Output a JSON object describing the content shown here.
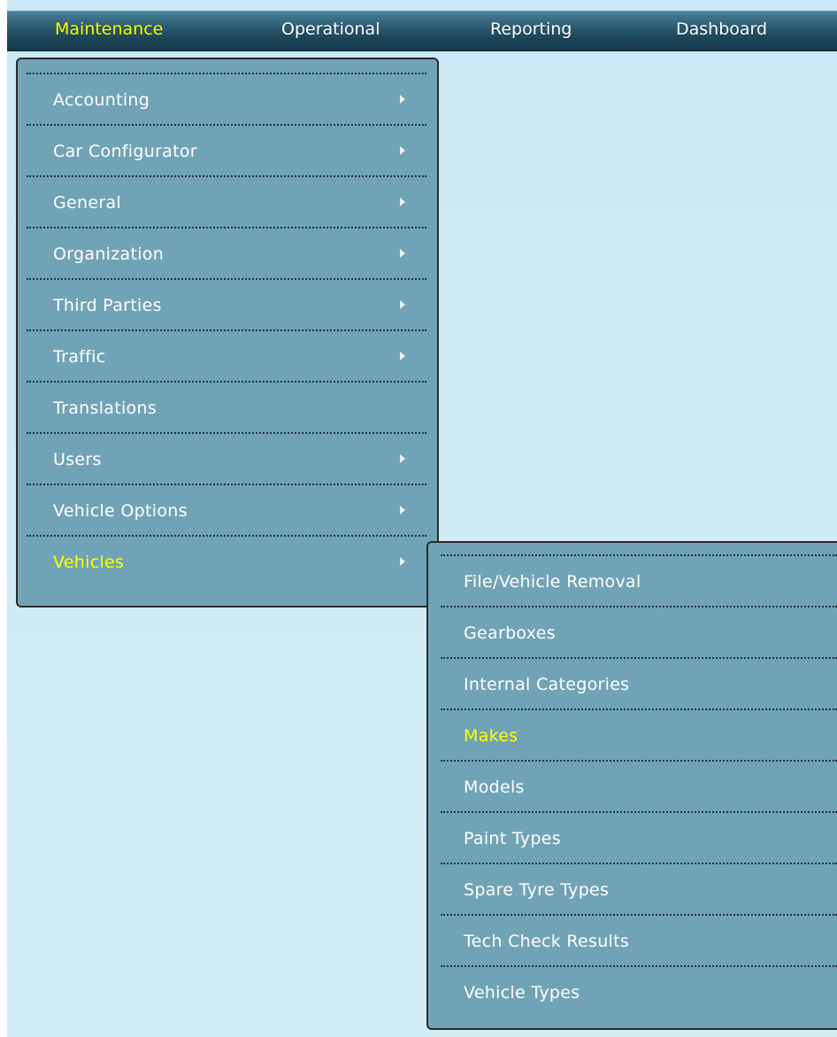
{
  "menubar": {
    "items": [
      {
        "label": "Maintenance",
        "active": true
      },
      {
        "label": "Operational",
        "active": false
      },
      {
        "label": "Reporting",
        "active": false
      },
      {
        "label": "Dashboard",
        "active": false
      }
    ]
  },
  "maintenance_menu": {
    "items": [
      {
        "label": "Accounting",
        "has_submenu": true
      },
      {
        "label": "Car Configurator",
        "has_submenu": true
      },
      {
        "label": "General",
        "has_submenu": true
      },
      {
        "label": "Organization",
        "has_submenu": true
      },
      {
        "label": "Third Parties",
        "has_submenu": true
      },
      {
        "label": "Traffic",
        "has_submenu": true
      },
      {
        "label": "Translations",
        "has_submenu": false
      },
      {
        "label": "Users",
        "has_submenu": true
      },
      {
        "label": "Vehicle Options",
        "has_submenu": true
      },
      {
        "label": "Vehicles",
        "has_submenu": true,
        "active": true
      }
    ]
  },
  "vehicles_submenu": {
    "items": [
      {
        "label": "File/Vehicle Removal"
      },
      {
        "label": "Gearboxes"
      },
      {
        "label": "Internal Categories"
      },
      {
        "label": "Makes",
        "active": true
      },
      {
        "label": "Models"
      },
      {
        "label": "Paint Types"
      },
      {
        "label": "Spare Tyre Types"
      },
      {
        "label": "Tech Check Results"
      },
      {
        "label": "Vehicle Types"
      }
    ]
  },
  "colors": {
    "menubar_background": "#1c4458",
    "menu_background": "#71a3b6",
    "page_background": "#cfebf7",
    "active_text": "#ffff00",
    "text": "#ffffff"
  }
}
